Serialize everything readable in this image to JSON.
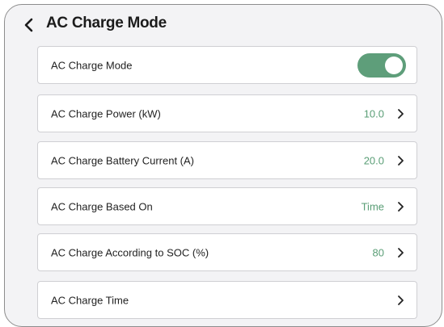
{
  "header": {
    "title": "AC Charge Mode",
    "back_icon": "chevron-left-icon"
  },
  "colors": {
    "accent": "#5e9e7a",
    "value_text": "#5a9e76",
    "panel_background": "#f3f3f5"
  },
  "settings": {
    "mode": {
      "label": "AC Charge Mode",
      "toggle_on": true
    },
    "power": {
      "label": "AC Charge Power (kW)",
      "value": "10.0"
    },
    "battery_current": {
      "label": "AC Charge Battery Current (A)",
      "value": "20.0"
    },
    "based_on": {
      "label": "AC Charge Based On",
      "value": "Time"
    },
    "soc": {
      "label": "AC Charge According to SOC (%)",
      "value": "80"
    },
    "time": {
      "label": "AC Charge Time"
    }
  }
}
